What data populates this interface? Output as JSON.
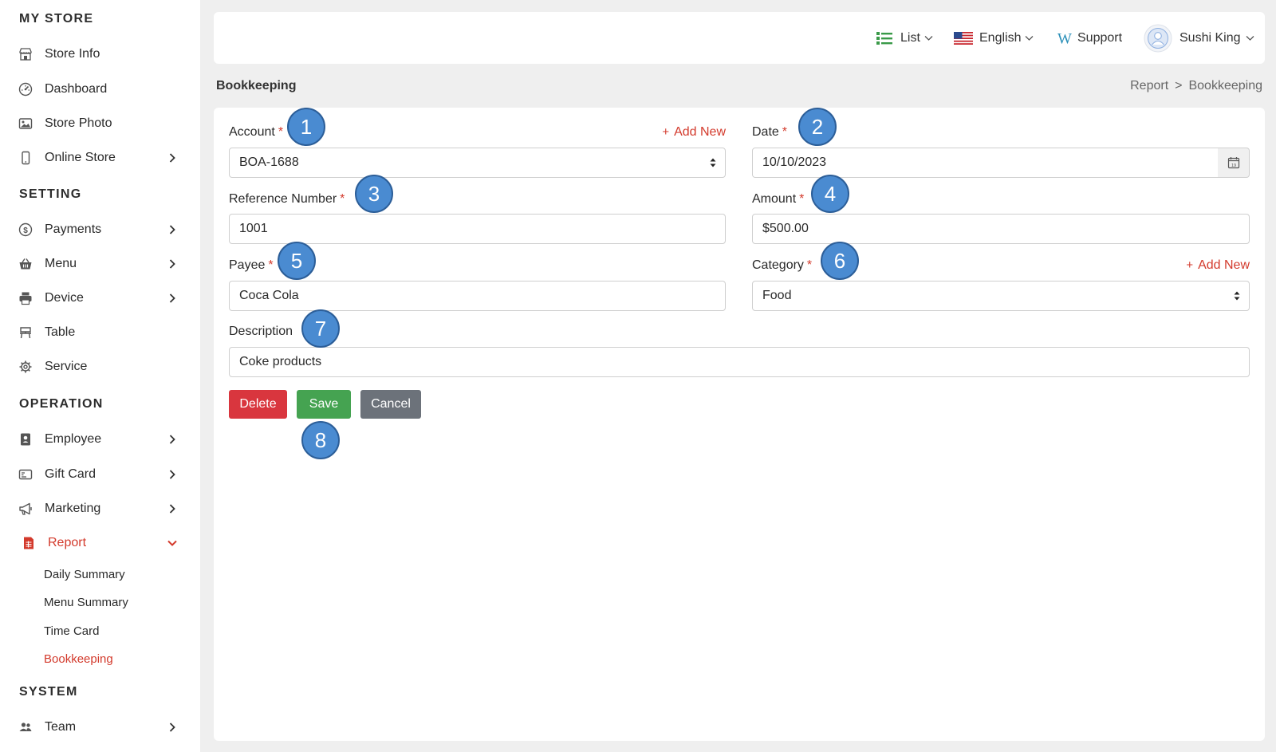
{
  "sidebar": {
    "sections": {
      "my_store": "MY STORE",
      "setting": "SETTING",
      "operation": "OPERATION",
      "system": "SYSTEM"
    },
    "items": {
      "store_info": "Store Info",
      "dashboard": "Dashboard",
      "store_photo": "Store Photo",
      "online_store": "Online Store",
      "payments": "Payments",
      "menu": "Menu",
      "device": "Device",
      "table": "Table",
      "service": "Service",
      "employee": "Employee",
      "gift_card": "Gift Card",
      "marketing": "Marketing",
      "report": "Report",
      "team": "Team"
    },
    "report_sub": {
      "daily_summary": "Daily Summary",
      "menu_summary": "Menu Summary",
      "time_card": "Time Card",
      "bookkeeping": "Bookkeeping"
    }
  },
  "topbar": {
    "view": "List",
    "language": "English",
    "support": "Support",
    "user": "Sushi King"
  },
  "page": {
    "title": "Bookkeeping",
    "breadcrumb": [
      "Report",
      ">",
      "Bookkeeping"
    ]
  },
  "form": {
    "account_label": "Account",
    "account_value": "BOA-1688",
    "add_new": "Add New",
    "date_label": "Date",
    "date_value": "10/10/2023",
    "reference_label": "Reference Number",
    "reference_value": "1001",
    "amount_label": "Amount",
    "amount_value": "$500.00",
    "payee_label": "Payee",
    "payee_value": "Coca Cola",
    "category_label": "Category",
    "category_value": "Food",
    "description_label": "Description",
    "description_value": "Coke products",
    "required_mark": "*"
  },
  "buttons": {
    "delete": "Delete",
    "save": "Save",
    "cancel": "Cancel"
  },
  "markers": [
    "1",
    "2",
    "3",
    "4",
    "5",
    "6",
    "7",
    "8"
  ],
  "colors": {
    "accent_red": "#d33a2c",
    "save_green": "#45a351",
    "delete_red": "#d9363e",
    "cancel_gray": "#6c727a",
    "marker_blue": "#4a8bd1"
  }
}
